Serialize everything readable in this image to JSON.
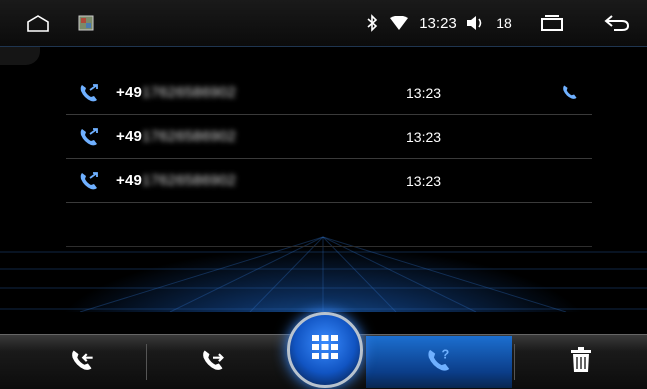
{
  "status_bar": {
    "time": "13:23",
    "volume_level": "18",
    "icons": [
      "home-icon",
      "gallery-icon",
      "bluetooth-icon",
      "wifi-icon",
      "volume-icon",
      "recent-apps-icon",
      "back-icon"
    ]
  },
  "call_log": {
    "entries": [
      {
        "number_visible": "+49",
        "number_obscured": "17626586902",
        "time": "13:23",
        "type": "missed-call-icon",
        "has_dial_button": true
      },
      {
        "number_visible": "+49",
        "number_obscured": "17626586902",
        "time": "13:23",
        "type": "missed-call-icon",
        "has_dial_button": false
      },
      {
        "number_visible": "+49",
        "number_obscured": "17626586902",
        "time": "13:23",
        "type": "missed-call-icon",
        "has_dial_button": false
      }
    ]
  },
  "bottom_nav": {
    "items": [
      "incoming-calls-icon",
      "outgoing-calls-icon",
      "keypad-icon",
      "missed-calls-icon",
      "delete-icon"
    ],
    "active": "missed-calls-icon"
  },
  "colors": {
    "accent": "#2a8cff",
    "icon_blue": "#6fb0ff",
    "background": "#000000"
  }
}
